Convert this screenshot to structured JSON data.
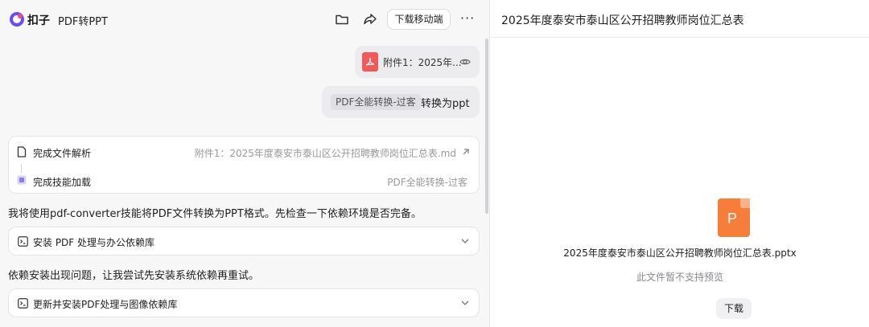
{
  "header": {
    "brand": "扣子",
    "doc_title": "PDF转PPT",
    "mobile_download": "下载移动端",
    "more": "···"
  },
  "chat": {
    "attachment": {
      "name": "附件1：2025年..."
    },
    "user_message": {
      "skill": "PDF全能转换-过客",
      "text": "转换为ppt"
    },
    "steps": [
      {
        "label": "完成文件解析",
        "meta": "附件1：2025年度泰安市泰山区公开招聘教师岗位汇总表.md"
      },
      {
        "label": "完成技能加载",
        "meta": "PDF全能转换-过客"
      }
    ],
    "paragraph1": "我将使用pdf-converter技能将PDF文件转换为PPT格式。先检查一下依赖环境是否完备。",
    "tool1": "安装 PDF 处理与办公依赖库",
    "paragraph2": "依赖安装出现问题，让我尝试先安装系统依赖再重试。",
    "tool2": "更新并安装PDF处理与图像依赖库"
  },
  "preview": {
    "title": "2025年度泰安市泰山区公开招聘教师岗位汇总表",
    "file_icon_letter": "P",
    "file_name": "2025年度泰安市泰山区公开招聘教师岗位汇总表.pptx",
    "notice": "此文件暂不支持预览",
    "download": "下载"
  },
  "colors": {
    "accent_pdf": "#f05a5a",
    "accent_ppt": "#f77e3a",
    "panel_bg": "#f7f7f8"
  }
}
